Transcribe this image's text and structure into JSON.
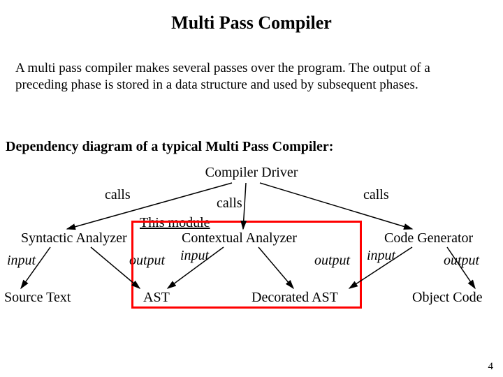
{
  "title": "Multi Pass Compiler",
  "description": "A multi pass compiler makes several passes over the program. The output of a preceding phase is stored in a data structure and used by subsequent phases.",
  "subheading": "Dependency diagram of a typical Multi Pass Compiler:",
  "diagram": {
    "driver": "Compiler Driver",
    "calls_left": "calls",
    "calls_mid": "calls",
    "calls_right": "calls",
    "this_module": "This module",
    "syntactic": "Syntactic Analyzer",
    "contextual": "Contextual Analyzer",
    "codegen": "Code Generator",
    "input1": "input",
    "output1": "output",
    "input2": "input",
    "output2": "output",
    "input3": "input",
    "output3": "output",
    "source_text": "Source Text",
    "ast": "AST",
    "decorated_ast": "Decorated AST",
    "object_code": "Object Code"
  },
  "page_number": "4"
}
